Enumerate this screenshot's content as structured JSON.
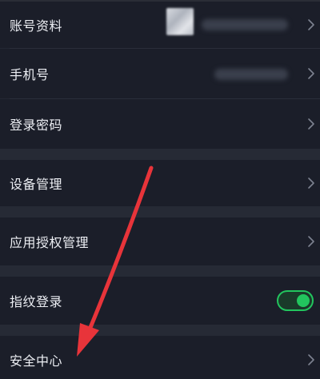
{
  "settings": {
    "items": [
      {
        "label": "账号资料"
      },
      {
        "label": "手机号"
      },
      {
        "label": "登录密码"
      },
      {
        "label": "设备管理"
      },
      {
        "label": "应用授权管理"
      },
      {
        "label": "指纹登录",
        "toggle_on": true
      },
      {
        "label": "安全中心"
      }
    ]
  },
  "colors": {
    "background": "#1b1e29",
    "section_gap": "#262a35",
    "toggle_accent": "#22c55e",
    "annotation_arrow": "#e8343a",
    "chevron": "#7d8290"
  },
  "icons": {
    "chevron": "chevron-right-icon",
    "annotation": "red-arrow-annotation"
  }
}
